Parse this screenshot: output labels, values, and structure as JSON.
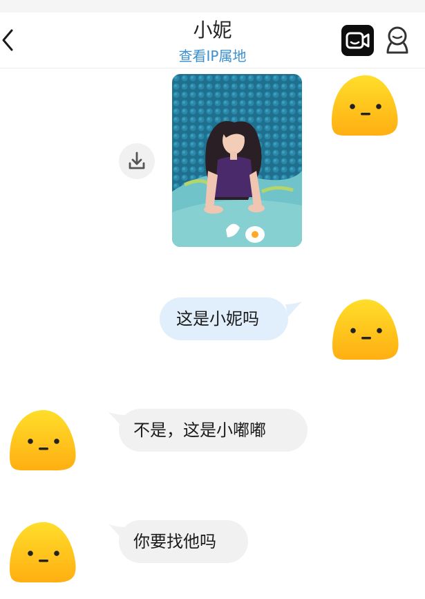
{
  "header": {
    "title": "小妮",
    "subtitle": "查看IP属地"
  },
  "icons": {
    "back": "chevron-left-icon",
    "video_call": "video-camera-icon",
    "profile": "person-outline-icon",
    "download": "download-icon",
    "avatar": "yellow-blob-avatar"
  },
  "colors": {
    "link": "#3a8fd1",
    "sent_bubble": "#e1eefb",
    "received_bubble": "#f1f1f1",
    "avatar_yellow": "#ffc81a"
  },
  "messages": [
    {
      "sender": "self",
      "type": "image"
    },
    {
      "sender": "self",
      "type": "text",
      "text": "这是小妮吗"
    },
    {
      "sender": "other",
      "type": "text",
      "text": "不是，这是小嘟嘟"
    },
    {
      "sender": "other",
      "type": "text",
      "text": "你要找他吗"
    }
  ]
}
